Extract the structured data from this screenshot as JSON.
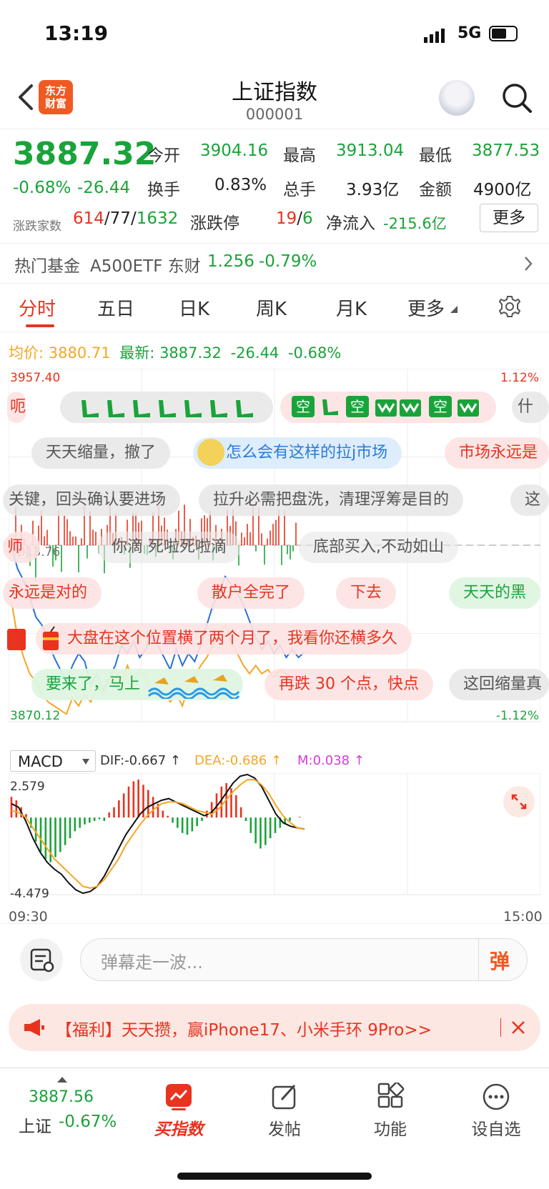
{
  "status": {
    "time": "13:19",
    "network": "5G"
  },
  "header": {
    "logo_line1": "东方",
    "logo_line2": "财富",
    "title": "上证指数",
    "code": "000001"
  },
  "quote": {
    "price": "3887.32",
    "change_pct": "-0.68%",
    "change": "-26.44",
    "open_label": "今开",
    "open": "3904.16",
    "high_label": "最高",
    "high": "3913.04",
    "low_label": "最低",
    "low": "3877.53",
    "turnover_label": "换手",
    "turnover": "0.83%",
    "volume_label": "总手",
    "volume": "3.93亿",
    "amount_label": "金额",
    "amount": "4900亿",
    "breadth_label": "涨跌家数",
    "up": "614",
    "flat": "77",
    "down": "1632",
    "sep": "/",
    "limit_label": "涨跌停",
    "limit_up": "19",
    "limit_down": "6",
    "netflow_label": "净流入",
    "netflow": "-215.6亿",
    "more_label": "更多"
  },
  "fund": {
    "label": "热门基金",
    "name": "A500ETF 东财",
    "price": "1.256",
    "change": "-0.79%"
  },
  "tabs": [
    "分时",
    "五日",
    "日K",
    "周K",
    "月K",
    "更多"
  ],
  "summary": {
    "avg_label": "均价:",
    "avg": "3880.71",
    "last_label": "最新:",
    "last": "3887.32",
    "change": "-26.44",
    "pct": "-0.68%"
  },
  "chart_data": [
    {
      "type": "line",
      "title": "",
      "ylim": [
        3870.12,
        3957.4
      ],
      "y_top_label": "3957.40",
      "y_bottom_label": "3870.12",
      "y_mid_label": "3913.76",
      "pct_top": "1.12%",
      "pct_bottom": "-1.12%",
      "series": [
        {
          "name": "最新",
          "values": [
            3913.5,
            3908,
            3905,
            3901,
            3896,
            3894,
            3890,
            3886,
            3883,
            3880,
            3884,
            3887,
            3885,
            3879,
            3882,
            3878,
            3881,
            3884,
            3889,
            3887,
            3890,
            3886,
            3888,
            3892,
            3889,
            3886,
            3883,
            3888,
            3884,
            3887,
            3885,
            3889,
            3894,
            3899,
            3902,
            3906,
            3904,
            3902,
            3899,
            3895,
            3891,
            3888,
            3890,
            3887,
            3889,
            3886,
            3888,
            3886,
            3887.32
          ],
          "color": "#2a6fd6"
        },
        {
          "name": "均价",
          "values": [
            3900,
            3891,
            3886,
            3882,
            3880,
            3877,
            3875,
            3874,
            3873,
            3872,
            3876,
            3874,
            3877,
            3875,
            3879,
            3877,
            3880,
            3883,
            3880,
            3884,
            3880,
            3883,
            3881,
            3878,
            3876,
            3878,
            3875,
            3877,
            3874,
            3879,
            3881,
            3884,
            3886,
            3889,
            3892,
            3894,
            3890,
            3887,
            3884,
            3882,
            3884,
            3882,
            3883,
            3881,
            3883,
            3882,
            3881,
            3880,
            3880.71
          ],
          "color": "#f5a623"
        }
      ]
    },
    {
      "type": "bar",
      "title": "",
      "indicator": "MACD",
      "dif_label": "DIF:-0.667 ↑",
      "dea_label": "DEA:-0.686 ↑",
      "m_label": "M:0.038 ↑",
      "y_top_label": "2.579",
      "y_bottom_label": "-4.479",
      "x_start": "09:30",
      "x_end": "15:00",
      "ylim": [
        -4.479,
        2.579
      ],
      "histogram": [
        1.2,
        1.0,
        0.6,
        0.2,
        -0.6,
        -1.4,
        -2.0,
        -2.4,
        -2.6,
        -2.3,
        -2.0,
        -1.6,
        -1.2,
        -0.8,
        -0.6,
        -0.4,
        -0.3,
        -0.2,
        -0.1,
        -0.2,
        0.3,
        0.6,
        1.0,
        1.4,
        1.8,
        2.1,
        2.2,
        1.9,
        1.6,
        1.2,
        0.8,
        0.4,
        0.1,
        -0.3,
        -0.6,
        -0.9,
        -1.0,
        -0.8,
        -0.5,
        -0.2,
        0.4,
        0.9,
        1.4,
        1.8,
        2.0,
        1.7,
        1.3,
        0.6,
        -0.2,
        -0.9,
        -1.5,
        -1.8,
        -1.6,
        -1.2,
        -0.9,
        -0.6,
        -0.4,
        -0.2,
        0.0,
        0.04
      ],
      "dif": [
        0.8,
        0.6,
        -0.2,
        -1.2,
        -2.0,
        -2.6,
        -3.0,
        -3.3,
        -3.8,
        -4.2,
        -4.4,
        -4.3,
        -4.0,
        -3.4,
        -2.6,
        -1.8,
        -1.0,
        -0.4,
        0.2,
        0.6,
        0.8,
        1.0,
        1.1,
        0.9,
        0.7,
        0.5,
        0.3,
        0.1,
        0.3,
        0.8,
        1.4,
        2.0,
        2.4,
        2.5,
        2.3,
        1.8,
        1.0,
        0.2,
        -0.3,
        -0.5,
        -0.6,
        -0.667
      ],
      "dea": [
        0.4,
        0.3,
        0.0,
        -0.6,
        -1.2,
        -1.8,
        -2.4,
        -2.8,
        -3.2,
        -3.6,
        -4.0,
        -4.1,
        -4.0,
        -3.6,
        -3.0,
        -2.4,
        -1.6,
        -1.0,
        -0.4,
        0.1,
        0.5,
        0.8,
        0.9,
        0.9,
        0.8,
        0.6,
        0.4,
        0.3,
        0.2,
        0.5,
        1.0,
        1.5,
        1.9,
        2.2,
        2.2,
        1.9,
        1.4,
        0.7,
        0.1,
        -0.3,
        -0.6,
        -0.686
      ]
    }
  ],
  "danmu": [
    {
      "text": "天天缩量，撤了",
      "style": "gray"
    },
    {
      "text": "怎么会有这样的拉j市场",
      "style": "blue"
    },
    {
      "text": "市场永远是",
      "style": "pink"
    },
    {
      "text": "关键，回头确认要进场",
      "style": "gray"
    },
    {
      "text": "拉升必需把盘洗，清理浮筹是目的",
      "style": "gray"
    },
    {
      "text": "这",
      "style": "gray"
    },
    {
      "text": "你滴  死啦死啦滴",
      "style": "gray"
    },
    {
      "text": "底部买入,不动如山",
      "style": "gray"
    },
    {
      "text": "永远是对的",
      "style": "pink"
    },
    {
      "text": "散户全完了",
      "style": "pink"
    },
    {
      "text": "下去",
      "style": "pink"
    },
    {
      "text": "天天的黑",
      "style": "green"
    },
    {
      "text": "大盘在这个位置横了两个月了，我看你还横多久",
      "style": "pink"
    },
    {
      "text": "要来了，马上",
      "style": "green"
    },
    {
      "text": "再跌 30 个点，快点",
      "style": "pink"
    },
    {
      "text": "这回缩量真",
      "style": "gray"
    },
    {
      "text": "空",
      "style": "green"
    },
    {
      "text": "什",
      "style": "gray"
    },
    {
      "text": "呃",
      "style": "pink"
    },
    {
      "text": "师",
      "style": "pink"
    }
  ],
  "comment": {
    "placeholder": "弹幕走一波...",
    "send_label": "弹"
  },
  "promo": {
    "text": "【福利】天天攒，赢iPhone17、小米手环 9Pro>>"
  },
  "bottom_nav": {
    "index_value": "3887.56",
    "index_name": "上证",
    "index_change": "-0.67%",
    "buy_label": "买指数",
    "post_label": "发帖",
    "func_label": "功能",
    "watch_label": "设自选"
  },
  "colors": {
    "up": "#e8331f",
    "down": "#1aa33a",
    "price_line": "#2a6fd6",
    "avg_line": "#f5a623",
    "accent": "#f05a22"
  }
}
